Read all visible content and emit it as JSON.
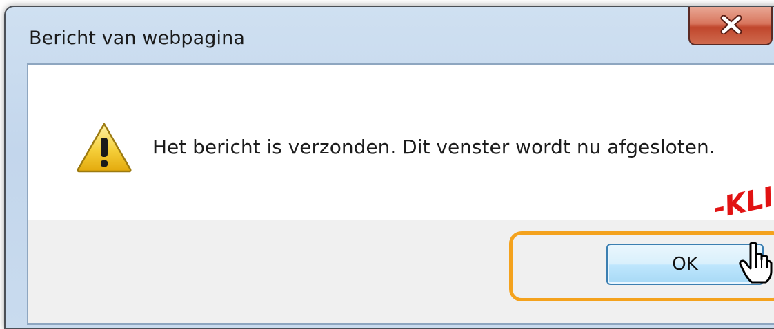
{
  "dialog": {
    "title": "Bericht van webpagina",
    "message": "Het bericht is verzonden. Dit venster wordt nu afgesloten.",
    "ok_label": "OK",
    "close_label": "X",
    "icon": "warning-icon"
  },
  "annotation": {
    "click_text": "-KLI",
    "highlight_color": "#f4a21d",
    "text_color": "#e11313",
    "cursor_icon": "hand-pointer-icon"
  }
}
